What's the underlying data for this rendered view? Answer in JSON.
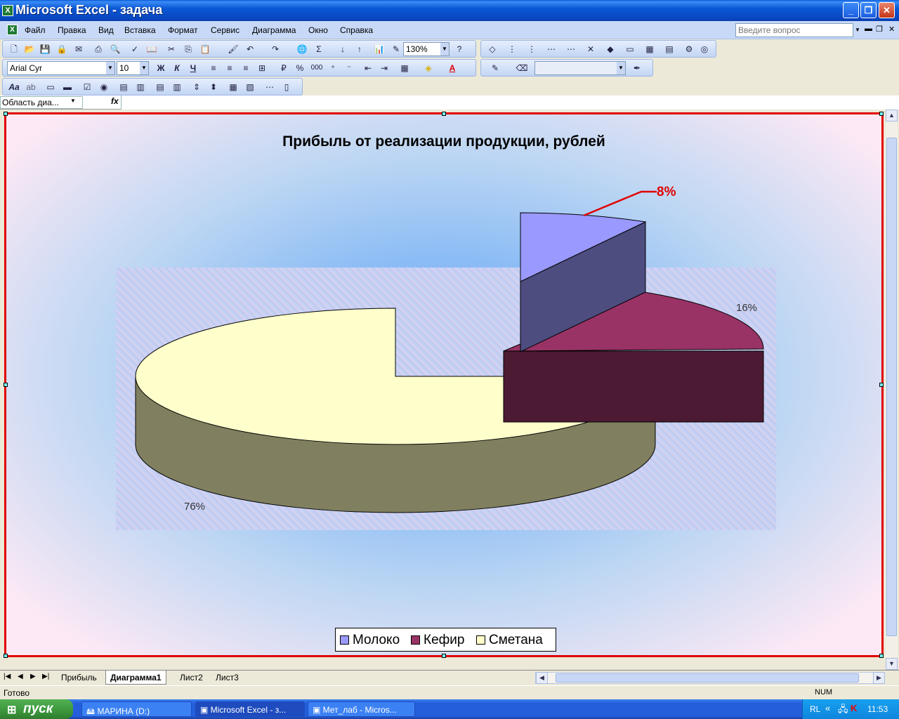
{
  "window": {
    "title": "Microsoft Excel - задача",
    "app_icon": "excel-icon"
  },
  "menu": [
    "Файл",
    "Правка",
    "Вид",
    "Вставка",
    "Формат",
    "Сервис",
    "Диаграмма",
    "Окно",
    "Справка"
  ],
  "ask_placeholder": "Введите вопрос",
  "toolbar": {
    "zoom": "130%",
    "font_name": "Arial Cyr",
    "font_size": "10",
    "bold": "Ж",
    "italic": "К",
    "underline": "Ч",
    "sigma": "Σ",
    "percent": "%",
    "thousands": "000"
  },
  "name_box": "Область диа...",
  "fx_label": "fx",
  "chart_data": {
    "type": "pie",
    "style": "3d-exploded",
    "title": "Прибыль от реализации продукции, рублей",
    "categories": [
      "Молоко",
      "Кефир",
      "Сметана"
    ],
    "values": [
      8,
      16,
      76
    ],
    "labels": [
      "8%",
      "16%",
      "76%"
    ],
    "colors": [
      "#9999ff",
      "#993366",
      "#ffffcc"
    ],
    "legend_placement": "bottom"
  },
  "sheet_tabs": [
    {
      "label": "Прибыль",
      "active": false
    },
    {
      "label": "Диаграмма1",
      "active": true
    },
    {
      "label": "Лист2",
      "active": false
    },
    {
      "label": "Лист3",
      "active": false
    }
  ],
  "status": {
    "text": "Готово",
    "num": "NUM"
  },
  "taskbar": {
    "start": "пуск",
    "tasks": [
      {
        "label": "МАРИНА (D:)",
        "active": false
      },
      {
        "label": "Microsoft Excel - з...",
        "active": true
      },
      {
        "label": "Мет_лаб - Micros...",
        "active": false
      }
    ],
    "lang": "RL",
    "clock": "11:53"
  }
}
